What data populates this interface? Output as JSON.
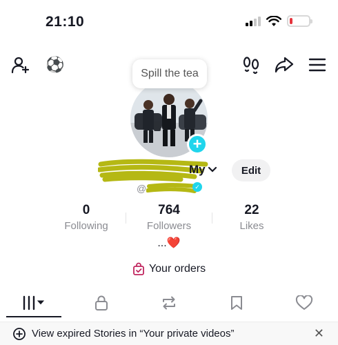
{
  "status_bar": {
    "time": "21:10",
    "icons": [
      "cellular-signal-icon",
      "wifi-icon",
      "battery-low-icon"
    ],
    "battery_color": "#e5343d"
  },
  "top_nav": {
    "left_icons": [
      "add-friend-icon",
      "soccer-ball-emoji"
    ],
    "ball_emoji": "⚽",
    "right_icons": [
      "footprints-icon",
      "share-arrow-icon",
      "menu-icon"
    ]
  },
  "profile": {
    "note": "Spill the tea",
    "name_partial": "My",
    "name_chevron": "⌄",
    "edit_label": "Edit",
    "handle_prefix": "@",
    "stats": [
      {
        "value": "0",
        "label": "Following"
      },
      {
        "value": "764",
        "label": "Followers"
      },
      {
        "value": "22",
        "label": "Likes"
      }
    ],
    "bio_dots": "...",
    "bio_heart": "❤️",
    "orders_label": "Your orders"
  },
  "tabs": [
    {
      "name": "videos",
      "icon": "grid-bars-icon",
      "active": true
    },
    {
      "name": "private",
      "icon": "lock-icon",
      "active": false
    },
    {
      "name": "reposts",
      "icon": "repost-icon",
      "active": false
    },
    {
      "name": "favorites",
      "icon": "bookmark-icon",
      "active": false
    },
    {
      "name": "liked",
      "icon": "heart-outline-icon",
      "active": false
    }
  ],
  "banner": {
    "text": "View expired Stories in “Your private videos”",
    "close": "✕"
  },
  "colors": {
    "accent": "#20d5ec",
    "text": "#161823",
    "muted": "#8a8b91",
    "scribble": "#b5b814"
  }
}
